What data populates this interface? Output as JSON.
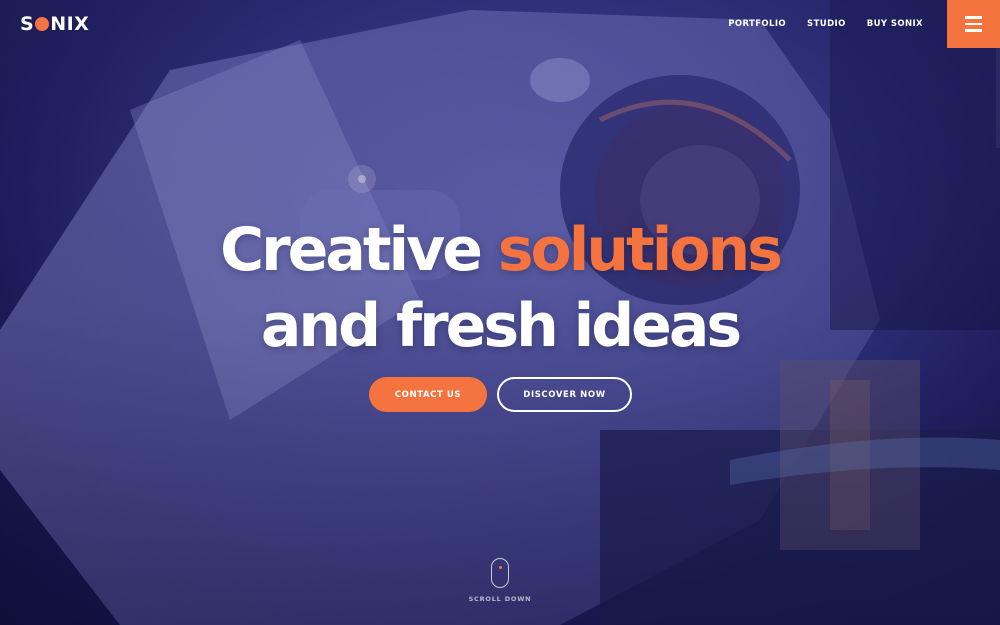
{
  "brand": {
    "logo_pre": "S",
    "logo_post": "NIX",
    "accent_color": "#f4733e"
  },
  "nav": {
    "items": [
      "PORTFOLIO",
      "STUDIO",
      "BUY SONIX"
    ],
    "menu_icon": "hamburger-icon"
  },
  "hero": {
    "headline_line1_a": "Creative ",
    "headline_line1_b": "solutions",
    "headline_line2": "and fresh ideas",
    "primary_button": "CONTACT US",
    "secondary_button": "DISCOVER NOW",
    "scroll_label": "SCROLL DOWN",
    "scroll_icon": "mouse-icon"
  }
}
